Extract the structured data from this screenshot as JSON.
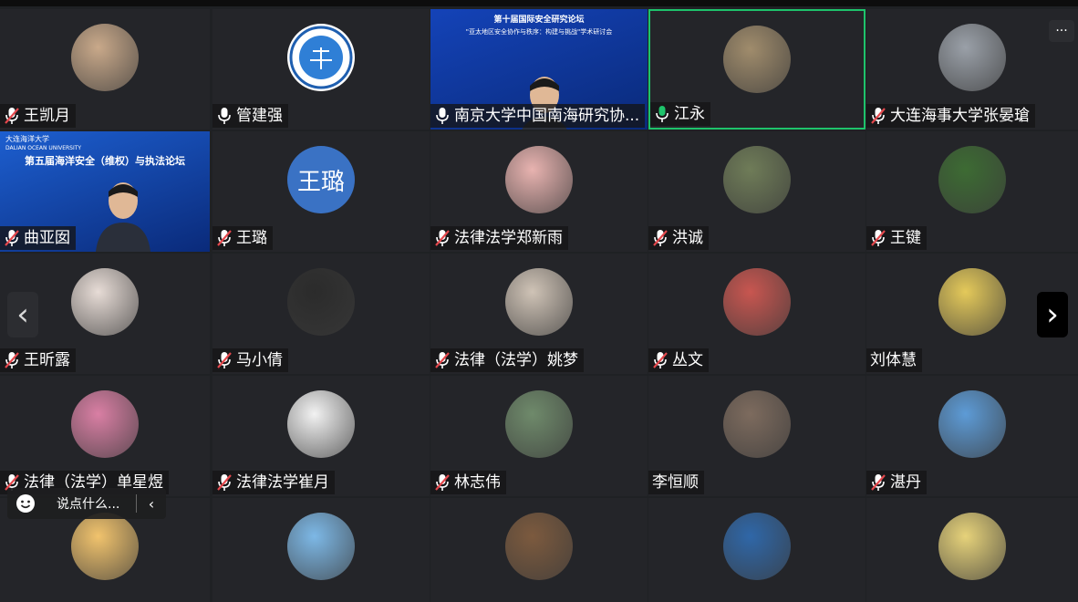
{
  "tiles": [
    {
      "name": "王凯月",
      "mic": "muted",
      "avatar": "photo",
      "color": "#c9a98a"
    },
    {
      "name": "管建强",
      "mic": "on",
      "avatar": "emblem",
      "color": "#ffffff"
    },
    {
      "name": "南京大学中国南海研究协...",
      "mic": "on",
      "avatar": "video",
      "color": "#1443b8",
      "video_title": "第十届国际安全研究论坛",
      "video_subtitle": "\"亚太地区安全协作与秩序：构建与挑战\"学术研讨会"
    },
    {
      "name": "江永",
      "mic": "speaking",
      "avatar": "photo",
      "color": "#a08c6c",
      "active": true
    },
    {
      "name": "大连海事大学张晏瑲",
      "mic": "muted",
      "avatar": "photo",
      "color": "#9aa0a8"
    },
    {
      "name": "曲亚囡",
      "mic": "muted",
      "avatar": "video",
      "color": "#1d5fd0",
      "video_logo": "大连海洋大学",
      "video_logo_en": "DALIAN OCEAN UNIVERSITY",
      "video_title": "第五届海洋安全（维权）与执法论坛"
    },
    {
      "name": "王璐",
      "mic": "muted",
      "avatar": "text",
      "initials": "王璐",
      "color": "#3a72c4"
    },
    {
      "name": "法律法学郑新雨",
      "mic": "muted",
      "avatar": "photo",
      "color": "#e8b3b0"
    },
    {
      "name": "洪诚",
      "mic": "muted",
      "avatar": "photo",
      "color": "#6f7c58"
    },
    {
      "name": "王键",
      "mic": "muted",
      "avatar": "photo",
      "color": "#3d6b33"
    },
    {
      "name": "王昕露",
      "mic": "muted",
      "avatar": "photo",
      "color": "#e7dcd6"
    },
    {
      "name": "马小倩",
      "mic": "muted",
      "avatar": "photo",
      "color": "#2b2b2b"
    },
    {
      "name": "法律（法学）姚梦",
      "mic": "muted",
      "avatar": "photo",
      "color": "#cfc3b6"
    },
    {
      "name": "丛文",
      "mic": "muted",
      "avatar": "photo",
      "color": "#c85650"
    },
    {
      "name": "刘体慧",
      "mic": "none",
      "avatar": "photo",
      "color": "#e4c95a"
    },
    {
      "name": "法律（法学）单星煜",
      "mic": "muted",
      "avatar": "photo",
      "color": "#d97fa4"
    },
    {
      "name": "法律法学崔月",
      "mic": "muted",
      "avatar": "photo",
      "color": "#f2f2f2"
    },
    {
      "name": "林志伟",
      "mic": "muted",
      "avatar": "photo",
      "color": "#6f8a6b"
    },
    {
      "name": "李恒顺",
      "mic": "none",
      "avatar": "photo",
      "color": "#7d6b5e"
    },
    {
      "name": "湛丹",
      "mic": "muted",
      "avatar": "photo",
      "color": "#5d9bd6"
    },
    {
      "name": "",
      "mic": "none",
      "avatar": "photo",
      "color": "#f1c36d"
    },
    {
      "name": "",
      "mic": "none",
      "avatar": "photo",
      "color": "#7db8e6"
    },
    {
      "name": "",
      "mic": "none",
      "avatar": "photo",
      "color": "#7c5a3e"
    },
    {
      "name": "",
      "mic": "none",
      "avatar": "photo",
      "color": "#2f67a8"
    },
    {
      "name": "",
      "mic": "none",
      "avatar": "photo",
      "color": "#e6d27a"
    }
  ],
  "nav": {
    "prev": "‹",
    "next": "›",
    "more": "···"
  },
  "chat": {
    "placeholder": "说点什么...",
    "collapse": "‹"
  },
  "colors": {
    "muted": "#e5484d",
    "speaking": "#1ec36b",
    "active_border": "#1ec36b"
  }
}
